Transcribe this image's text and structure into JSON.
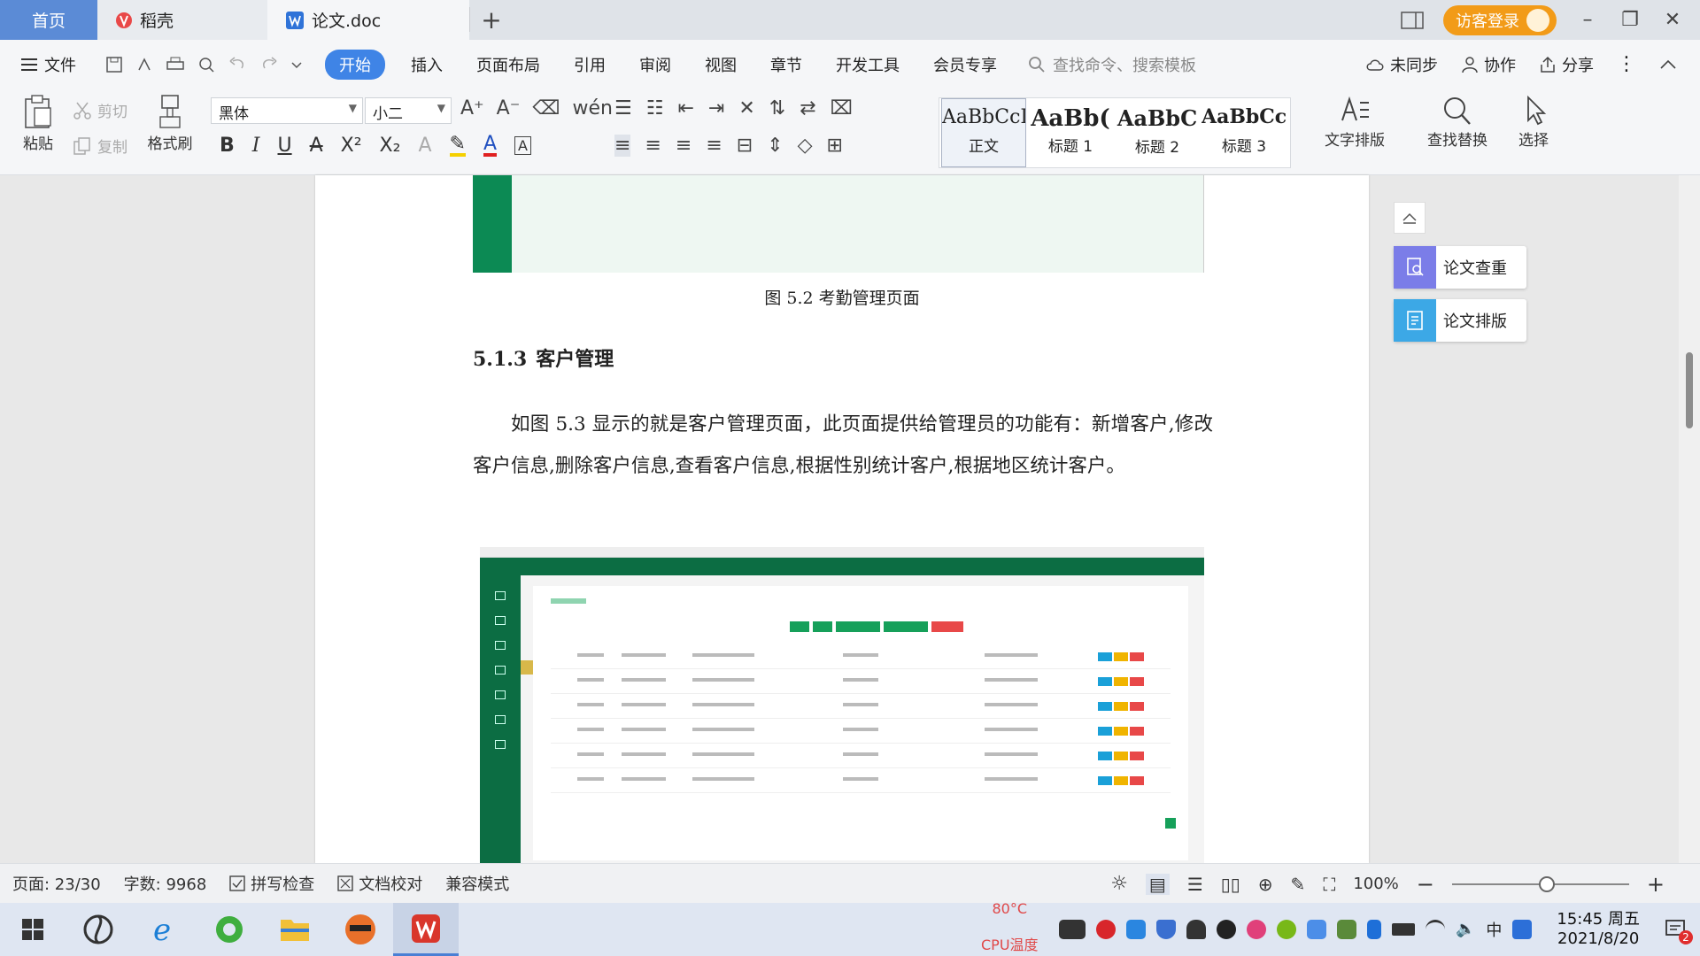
{
  "tabs": {
    "home": "首页",
    "daoke": "稻壳",
    "doc": "论文.doc",
    "plus": "+"
  },
  "title_right": {
    "login": "访客登录"
  },
  "menu": {
    "file": "文件",
    "items": [
      "开始",
      "插入",
      "页面布局",
      "引用",
      "审阅",
      "视图",
      "章节",
      "开发工具",
      "会员专享"
    ],
    "search_placeholder": "查找命令、搜索模板",
    "sync": "未同步",
    "collab": "协作",
    "share": "分享"
  },
  "ribbon": {
    "paste": "粘贴",
    "cut": "剪切",
    "copy": "复制",
    "format_painter": "格式刷",
    "font_name": "黑体",
    "font_size": "小二",
    "styles": [
      {
        "sample": "AaBbCcI",
        "name": "正文"
      },
      {
        "sample": "AaBb(",
        "name": "标题 1"
      },
      {
        "sample": "AaBbC",
        "name": "标题 2"
      },
      {
        "sample": "AaBbCcl",
        "name": "标题 3"
      }
    ],
    "text_layout": "文字排版",
    "find_replace": "查找替换",
    "select": "选择"
  },
  "document": {
    "figure_caption": "图 5.2  考勤管理页面",
    "heading_num": "5.1.3",
    "heading_text": "客户管理",
    "paragraph": "如图 5.3 显示的就是客户管理页面，此页面提供给管理员的功能有：新增客户,修改客户信息,删除客户信息,查看客户信息,根据性别统计客户,根据地区统计客户。"
  },
  "side_panel": {
    "check": "论文查重",
    "layout": "论文排版"
  },
  "status": {
    "page": "页面: 23/30",
    "words": "字数: 9968",
    "spell": "拼写检查",
    "proof": "文档校对",
    "compat": "兼容模式",
    "zoom": "100%"
  },
  "taskbar": {
    "cpu_temp": "80°C",
    "cpu_label": "CPU温度",
    "ime": "中",
    "time": "15:45 周五",
    "date": "2021/8/20",
    "badge": "2"
  },
  "colors": {
    "accent": "#3f84e6",
    "login": "#f29b18",
    "figure_green": "#0c8a54"
  }
}
